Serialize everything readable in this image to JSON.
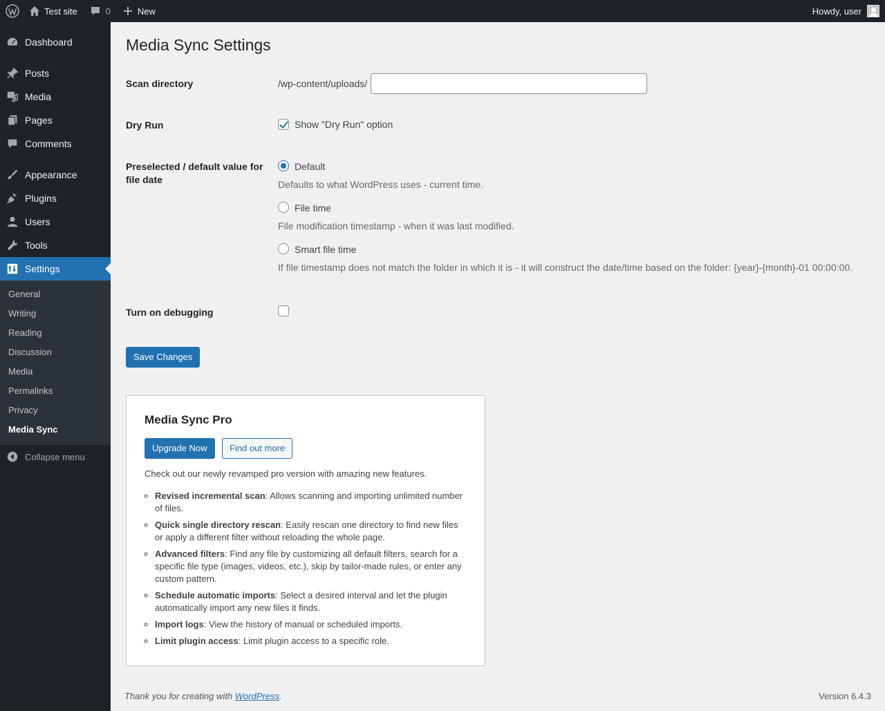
{
  "adminbar": {
    "site_name": "Test site",
    "comments_count": "0",
    "new_label": "New",
    "greeting": "Howdy, user"
  },
  "sidebar": {
    "items": [
      {
        "label": "Dashboard",
        "icon": "dashboard-icon"
      },
      {
        "label": "Posts",
        "icon": "pin-icon"
      },
      {
        "label": "Media",
        "icon": "media-icon"
      },
      {
        "label": "Pages",
        "icon": "pages-icon"
      },
      {
        "label": "Comments",
        "icon": "comment-icon"
      },
      {
        "label": "Appearance",
        "icon": "brush-icon"
      },
      {
        "label": "Plugins",
        "icon": "plug-icon"
      },
      {
        "label": "Users",
        "icon": "user-icon"
      },
      {
        "label": "Tools",
        "icon": "wrench-icon"
      },
      {
        "label": "Settings",
        "icon": "settings-icon"
      }
    ],
    "submenu": [
      "General",
      "Writing",
      "Reading",
      "Discussion",
      "Media",
      "Permalinks",
      "Privacy",
      "Media Sync"
    ],
    "collapse_label": "Collapse menu"
  },
  "page": {
    "title": "Media Sync Settings",
    "scan_directory": {
      "label": "Scan directory",
      "prefix": "/wp-content/uploads/",
      "value": ""
    },
    "dry_run": {
      "label": "Dry Run",
      "option_label": "Show \"Dry Run\" option",
      "checked": true
    },
    "file_date": {
      "label": "Preselected / default value for file date",
      "options": [
        {
          "label": "Default",
          "description": "Defaults to what WordPress uses - current time.",
          "checked": true
        },
        {
          "label": "File time",
          "description": "File modification timestamp - when it was last modified.",
          "checked": false
        },
        {
          "label": "Smart file time",
          "description": "If file timestamp does not match the folder in which it is - it will construct the date/time based on the folder: {year}-{month}-01 00:00:00.",
          "checked": false
        }
      ]
    },
    "debugging": {
      "label": "Turn on debugging",
      "checked": false
    },
    "save_label": "Save Changes"
  },
  "pro": {
    "title": "Media Sync Pro",
    "upgrade_label": "Upgrade Now",
    "find_out_label": "Find out more",
    "intro": "Check out our newly revamped pro version with amazing new features.",
    "features": [
      {
        "title": "Revised incremental scan",
        "text": ": Allows scanning and importing unlimited number of files."
      },
      {
        "title": "Quick single directory rescan",
        "text": ": Easily rescan one directory to find new files or apply a different filter without reloading the whole page."
      },
      {
        "title": "Advanced filters",
        "text": ": Find any file by customizing all default filters, search for a specific file type (images, videos, etc.), skip by tailor-made rules, or enter any custom pattern."
      },
      {
        "title": "Schedule automatic imports",
        "text": ": Select a desired interval and let the plugin automatically import any new files it finds."
      },
      {
        "title": "Import logs",
        "text": ": View the history of manual or scheduled imports."
      },
      {
        "title": "Limit plugin access",
        "text": ": Limit plugin access to a specific role."
      }
    ]
  },
  "footer": {
    "thanks_prefix": "Thank you for creating with ",
    "wordpress_link": "WordPress",
    "thanks_suffix": ".",
    "version": "Version 6.4.3"
  },
  "colors": {
    "accent": "#2271b1",
    "admin_bg": "#1d2327",
    "submenu_bg": "#2c3338",
    "page_bg": "#f0f0f1"
  }
}
